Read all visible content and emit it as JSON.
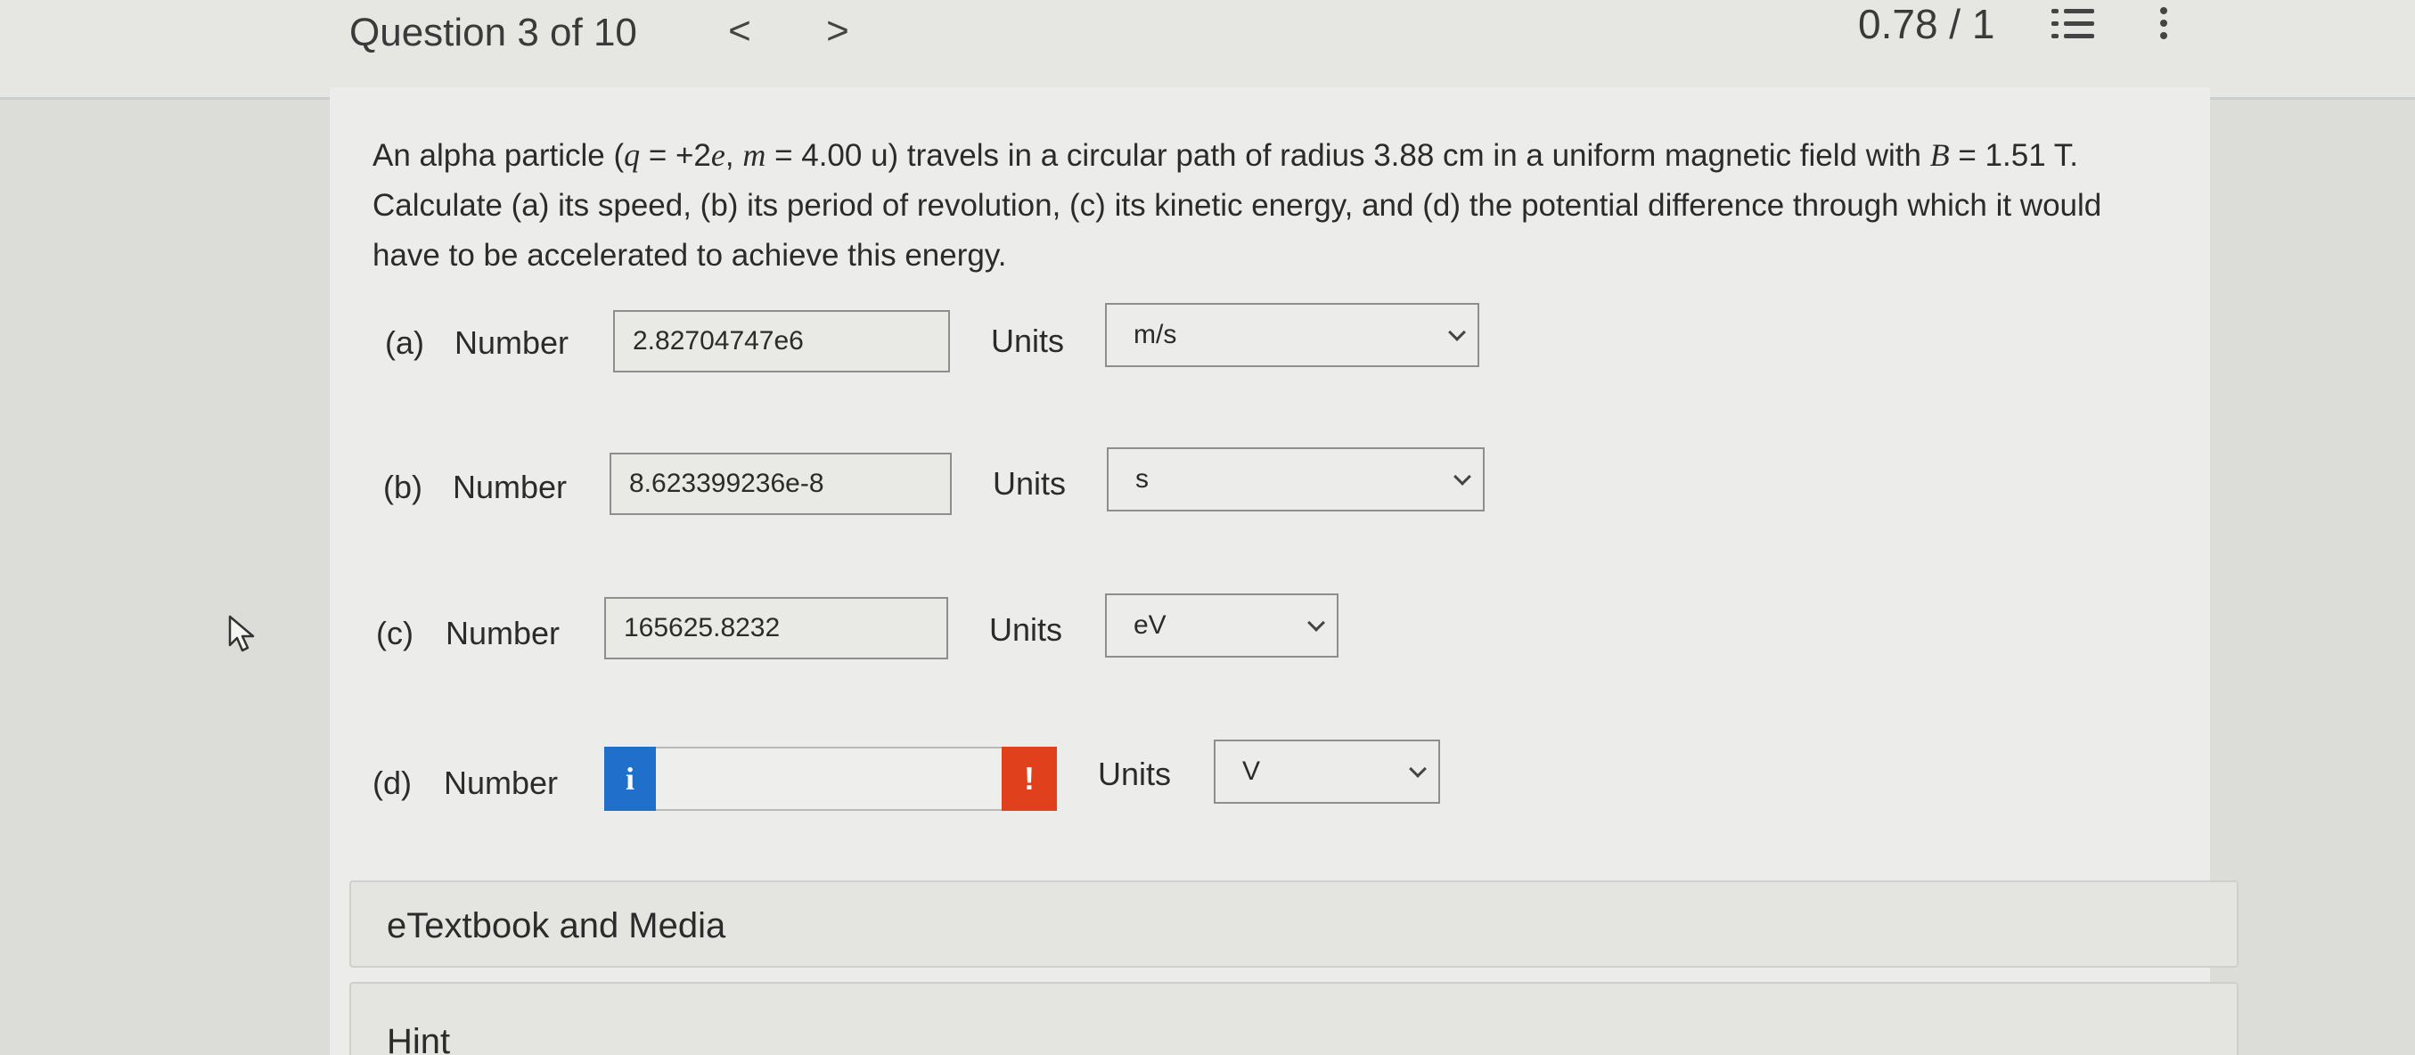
{
  "header": {
    "question_label": "Question 3 of 10",
    "prev_icon": "chevron-left-icon",
    "next_icon": "chevron-right-icon",
    "prev_glyph": "<",
    "next_glyph": ">",
    "score": "0.78 / 1",
    "list_icon": "numbered-list-icon",
    "more_icon": "more-vertical-icon"
  },
  "question": {
    "seg1": "An alpha particle (",
    "q_var": "q",
    "seg2": " = +2",
    "e_var": "e",
    "seg3": ", ",
    "m_var": "m",
    "seg4": " = 4.00 u) travels in a circular path of radius 3.88 cm in a uniform magnetic field with ",
    "b_var": "B",
    "seg5": " = 1.51 T. Calculate (a) its speed, (b) its period of revolution, (c) its kinetic energy, and (d) the potential difference through which it would have to be accelerated to achieve this energy."
  },
  "parts": [
    {
      "label": "(a)",
      "number_label": "Number",
      "value": "2.82704747e6",
      "units_label": "Units",
      "unit": "m/s"
    },
    {
      "label": "(b)",
      "number_label": "Number",
      "value": "8.623399236e-8",
      "units_label": "Units",
      "unit": "s"
    },
    {
      "label": "(c)",
      "number_label": "Number",
      "value": "165625.8232",
      "units_label": "Units",
      "unit": "eV"
    },
    {
      "label": "(d)",
      "number_label": "Number",
      "value": "",
      "units_label": "Units",
      "unit": "V",
      "info_glyph": "i",
      "warn_glyph": "!"
    }
  ],
  "accordions": {
    "etextbook": "eTextbook and Media",
    "hint": "Hint"
  },
  "colors": {
    "info_blue": "#1f6fcb",
    "warn_red": "#e0401c"
  }
}
